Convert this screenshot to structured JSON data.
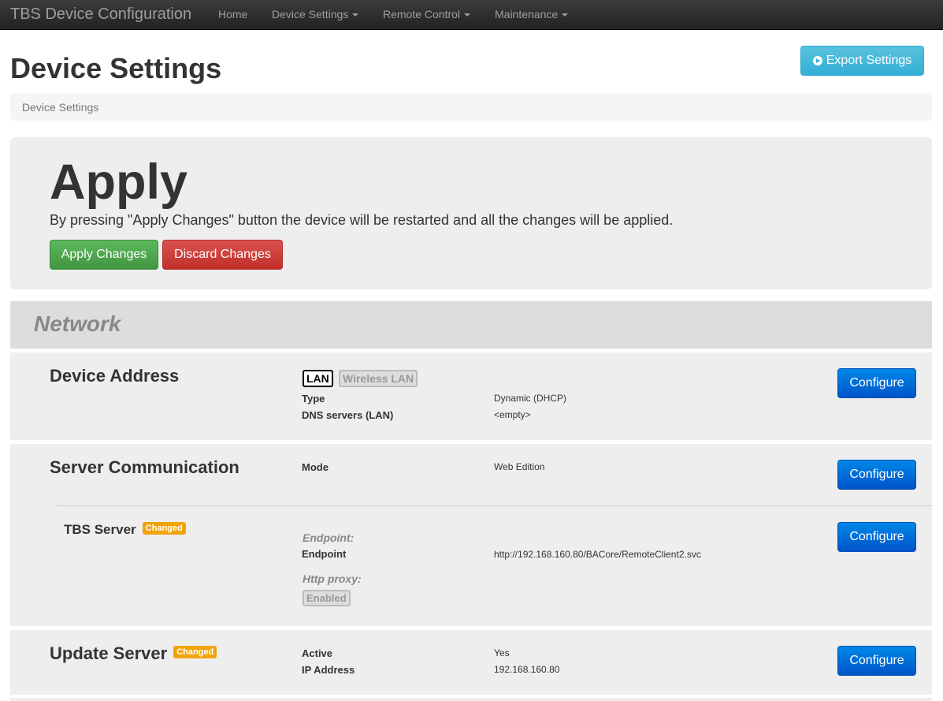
{
  "navbar": {
    "brand": "TBS Device Configuration",
    "items": [
      {
        "label": "Home",
        "dropdown": false
      },
      {
        "label": "Device Settings",
        "dropdown": true
      },
      {
        "label": "Remote Control",
        "dropdown": true
      },
      {
        "label": "Maintenance",
        "dropdown": true
      }
    ]
  },
  "header": {
    "title": "Device Settings",
    "export_label": "Export Settings",
    "breadcrumb": "Device Settings"
  },
  "apply": {
    "title": "Apply",
    "text": "By pressing \"Apply Changes\" button the device will be restarted and all the changes will be applied.",
    "apply_label": "Apply Changes",
    "discard_label": "Discard Changes"
  },
  "network": {
    "title": "Network",
    "configure_label": "Configure",
    "changed_label": "Changed",
    "device_address": {
      "title": "Device Address",
      "tabs": [
        "LAN",
        "Wireless LAN"
      ],
      "rows": [
        {
          "label": "Type",
          "value": "Dynamic (DHCP)"
        },
        {
          "label": "DNS servers (LAN)",
          "value": "<empty>"
        }
      ]
    },
    "server_communication": {
      "title": "Server Communication",
      "rows": [
        {
          "label": "Mode",
          "value": "Web Edition"
        }
      ],
      "tbs_server": {
        "title": "TBS Server",
        "endpoint_heading": "Endpoint:",
        "endpoint_label": "Endpoint",
        "endpoint_value": "http://192.168.160.80/BACore/RemoteClient2.svc",
        "proxy_heading": "Http proxy:",
        "proxy_state": "Enabled"
      }
    },
    "update_server": {
      "title": "Update Server",
      "rows": [
        {
          "label": "Active",
          "value": "Yes"
        },
        {
          "label": "IP Address",
          "value": "192.168.160.80"
        }
      ]
    }
  },
  "colors": {
    "navbar": "#222222",
    "export_button": "#31b0d5",
    "apply_button": "#5cb85c",
    "discard_button": "#d9534f",
    "configure_button": "#0066d6",
    "changed_badge": "#f0a30a"
  }
}
